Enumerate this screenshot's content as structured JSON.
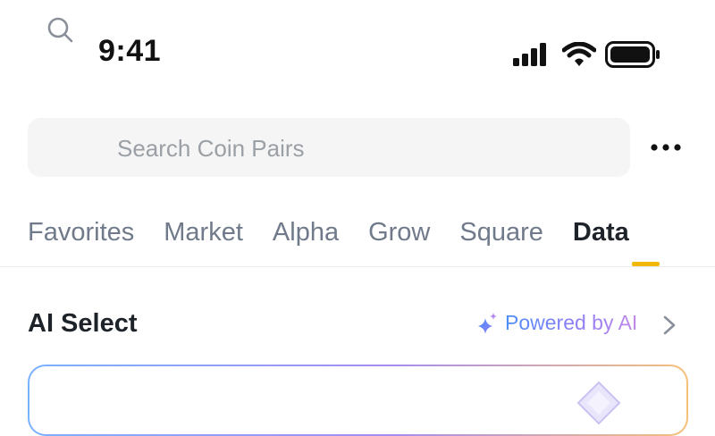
{
  "status_bar": {
    "time": "9:41",
    "icons": [
      "signal-icon",
      "wifi-icon",
      "battery-icon"
    ]
  },
  "search": {
    "placeholder": "Search Coin Pairs",
    "value": "",
    "icon": "search-icon"
  },
  "header": {
    "more_icon": "more-icon"
  },
  "tabs": [
    {
      "label": "Favorites",
      "active": false
    },
    {
      "label": "Market",
      "active": false
    },
    {
      "label": "Alpha",
      "active": false
    },
    {
      "label": "Grow",
      "active": false
    },
    {
      "label": "Square",
      "active": false
    },
    {
      "label": "Data",
      "active": true
    }
  ],
  "section": {
    "title": "AI Select",
    "powered_label": "Powered by AI",
    "sparkle_icon": "sparkle-icon",
    "chevron_icon": "chevron-right-icon"
  },
  "colors": {
    "accent": "#F0B90B",
    "text_primary": "#1E2329",
    "text_secondary": "#707A8A",
    "search_bg": "#F5F5F5",
    "ai_gradient_start": "#4D8EF7",
    "ai_gradient_mid": "#8F7DF5",
    "ai_gradient_end": "#F6C07A"
  }
}
